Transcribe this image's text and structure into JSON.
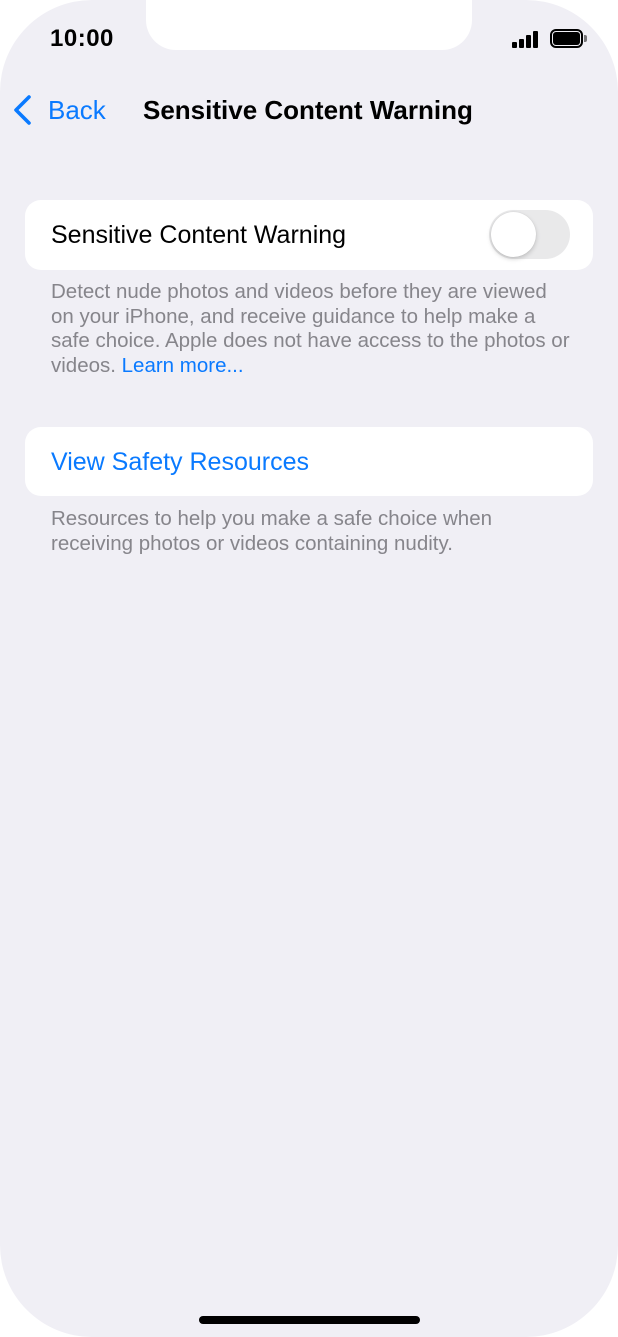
{
  "status_bar": {
    "time": "10:00",
    "signal_icon": "cellular-signal-icon",
    "battery_icon": "battery-full-icon"
  },
  "nav": {
    "back_label": "Back",
    "back_icon": "chevron-left-icon",
    "title": "Sensitive Content Warning"
  },
  "section_warning": {
    "toggle_label": "Sensitive Content Warning",
    "toggle_on": false,
    "footer_text": "Detect nude photos and videos before they are viewed on your iPhone, and receive guidance to help make a safe choice. Apple does not have access to the photos or videos.",
    "footer_link": "Learn more..."
  },
  "section_resources": {
    "link_label": "View Safety Resources",
    "footer_text": "Resources to help you make a safe choice when receiving photos or videos containing nudity."
  },
  "colors": {
    "background": "#f0eff5",
    "card": "#ffffff",
    "accent": "#0a7aff",
    "secondary_text": "#86858b",
    "toggle_off": "#e9e9ea"
  }
}
